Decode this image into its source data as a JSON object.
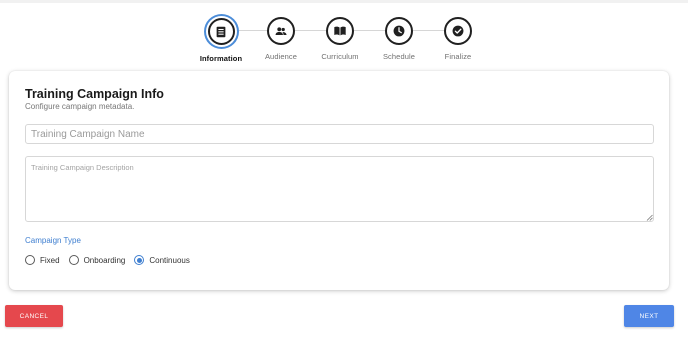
{
  "stepper": {
    "steps": [
      {
        "label": "Information",
        "icon": "document-list-icon",
        "active": true
      },
      {
        "label": "Audience",
        "icon": "people-icon",
        "active": false
      },
      {
        "label": "Curriculum",
        "icon": "open-book-icon",
        "active": false
      },
      {
        "label": "Schedule",
        "icon": "clock-icon",
        "active": false
      },
      {
        "label": "Finalize",
        "icon": "check-circle-icon",
        "active": false
      }
    ]
  },
  "card": {
    "title": "Training Campaign Info",
    "subtitle": "Configure campaign metadata.",
    "name_placeholder": "Training Campaign Name",
    "name_value": "",
    "description_placeholder": "Training Campaign Description",
    "description_value": "",
    "type_label": "Campaign Type",
    "type_options": [
      {
        "label": "Fixed",
        "checked": false
      },
      {
        "label": "Onboarding",
        "checked": false
      },
      {
        "label": "Continuous",
        "checked": true
      }
    ]
  },
  "actions": {
    "cancel_label": "CANCEL",
    "next_label": "NEXT"
  },
  "colors": {
    "accent": "#3f7fd0",
    "cancel": "#e5484d",
    "next": "#4f86e6"
  }
}
